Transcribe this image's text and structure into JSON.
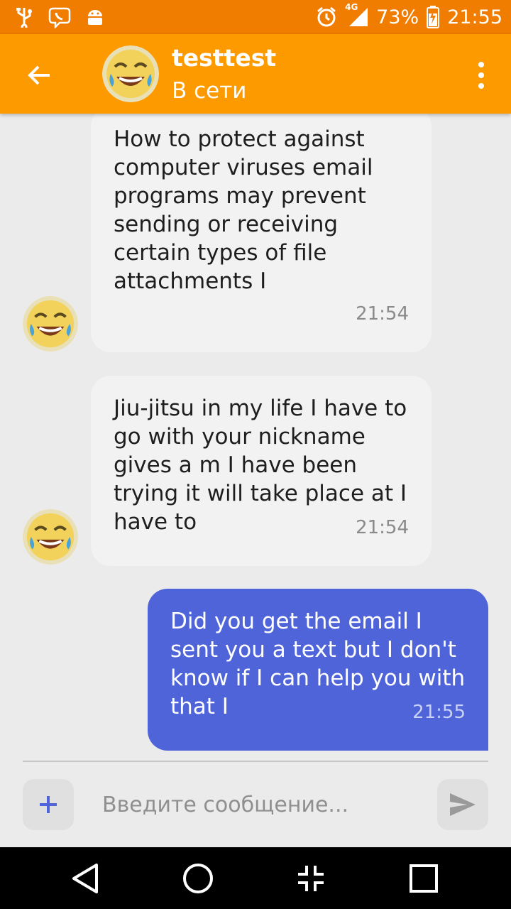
{
  "status_bar": {
    "network": "4G",
    "battery": "73%",
    "time": "21:55",
    "left_icons": [
      "usb-icon",
      "viber-icon",
      "android-icon"
    ],
    "right_icons": [
      "alarm-icon",
      "signal-icon",
      "battery-icon"
    ]
  },
  "header": {
    "contact_name": "testtest",
    "contact_status": "В сети",
    "back_icon": "back-arrow-icon",
    "menu_icon": "more-vert-icon"
  },
  "messages": [
    {
      "direction": "in",
      "text": "How to protect against computer viruses email programs may prevent sending or receiving certain types of file attachments I",
      "time": "21:54"
    },
    {
      "direction": "in",
      "text": "Jiu-jitsu in my life I have to go with your nickname gives a m I have been trying it will take place at I have to",
      "time": "21:54"
    },
    {
      "direction": "out",
      "text": "Did you get the email I sent you a text but I don't know if I can help you with that I",
      "time": "21:55"
    }
  ],
  "composer": {
    "placeholder": "Введите сообщение...",
    "add_icon": "plus-icon",
    "send_icon": "send-icon"
  },
  "nav_bar": {
    "icons": [
      "back-triangle-icon",
      "home-circle-icon",
      "collapse-icon",
      "recents-square-icon"
    ]
  },
  "colors": {
    "status_bar": "#f07c00",
    "app_bar": "#fd9a00",
    "incoming_bubble": "#f2f2f2",
    "outgoing_bubble": "#4f64d8",
    "background": "#ebebeb"
  }
}
